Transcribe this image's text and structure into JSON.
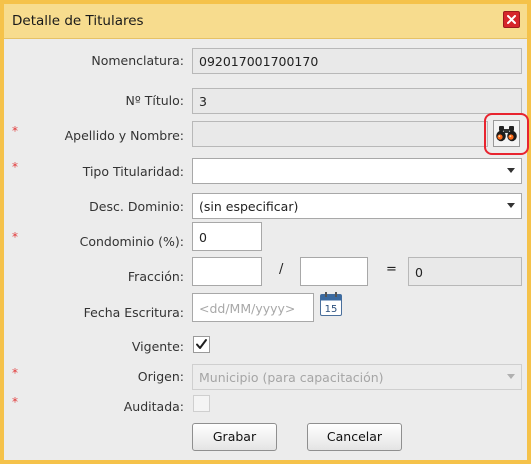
{
  "dialog": {
    "title": "Detalle de Titulares"
  },
  "form": {
    "nomenclatura": {
      "label": "Nomenclatura:",
      "value": "092017001700170"
    },
    "nro_titulo": {
      "label": "Nº Título:",
      "value": "3"
    },
    "apellido_nombre": {
      "label": "Apellido y Nombre:",
      "value": "",
      "required_mark": "*"
    },
    "tipo_titularidad": {
      "label": "Tipo Titularidad:",
      "value": "",
      "required_mark": "*"
    },
    "desc_dominio": {
      "label": "Desc. Dominio:",
      "value": "(sin especificar)"
    },
    "condominio": {
      "label": "Condominio (%):",
      "value": "0",
      "required_mark": "*"
    },
    "fraccion": {
      "label": "Fracción:",
      "numerador": "",
      "separator": "/",
      "denominador": "",
      "equals": "=",
      "resultado": "0"
    },
    "fecha_escritura": {
      "label": "Fecha Escritura:",
      "placeholder": "<dd/MM/yyyy>",
      "calendar_day": "15"
    },
    "vigente": {
      "label": "Vigente:",
      "checked": true
    },
    "origen": {
      "label": "Origen:",
      "value": "Municipio (para capacitación)",
      "required_mark": "*"
    },
    "auditada": {
      "label": "Auditada:",
      "checked": false,
      "required_mark": "*"
    }
  },
  "buttons": {
    "save": "Grabar",
    "cancel": "Cancelar"
  },
  "colors": {
    "title_bar": "#f7dc8e",
    "frame": "#f5c24a",
    "close": "#d6262b",
    "required": "#e23a3a",
    "highlight": "#e8242f"
  },
  "icons": {
    "close": "close-icon",
    "search": "binoculars-icon",
    "calendar": "calendar-icon",
    "check": "checkmark-icon"
  }
}
